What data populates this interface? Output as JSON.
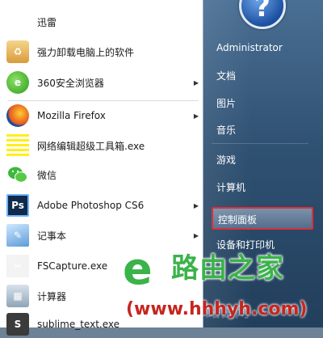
{
  "user": {
    "name": "Administrator",
    "avatar_glyph": "?"
  },
  "programs": [
    {
      "label": "迅雷",
      "icon": "xunlei-bird-icon",
      "icon_glyph": "✈",
      "has_arrow": false
    },
    {
      "label": "强力卸载电脑上的软件",
      "icon": "uninstall-box-icon",
      "icon_glyph": "♻",
      "has_arrow": false
    },
    {
      "label": "360安全浏览器",
      "icon": "360-browser-icon",
      "icon_glyph": "e",
      "has_arrow": true
    },
    {
      "label": "Mozilla Firefox",
      "icon": "firefox-icon",
      "icon_glyph": "",
      "has_arrow": true
    },
    {
      "label": "网络编辑超级工具箱.exe",
      "icon": "toolbox-yellow-icon",
      "icon_glyph": "",
      "has_arrow": false
    },
    {
      "label": "微信",
      "icon": "wechat-icon",
      "icon_glyph": "",
      "has_arrow": false
    },
    {
      "label": "Adobe Photoshop CS6",
      "icon": "photoshop-icon",
      "icon_glyph": "Ps",
      "has_arrow": true
    },
    {
      "label": "记事本",
      "icon": "notepad-icon",
      "icon_glyph": "✎",
      "has_arrow": true
    },
    {
      "label": "FSCapture.exe",
      "icon": "fscapture-icon",
      "icon_glyph": "✂",
      "has_arrow": false
    },
    {
      "label": "计算器",
      "icon": "calculator-icon",
      "icon_glyph": "▦",
      "has_arrow": false
    },
    {
      "label": "sublime_text.exe",
      "icon": "sublime-text-icon",
      "icon_glyph": "S",
      "has_arrow": false
    }
  ],
  "arrow_glyph": "▶",
  "right_items": [
    {
      "label": "文档"
    },
    {
      "label": "图片"
    },
    {
      "label": "音乐"
    },
    {
      "label": "游戏"
    },
    {
      "label": "计算机"
    },
    {
      "label": "控制面板",
      "highlighted": true
    },
    {
      "label": "设备和打印机"
    }
  ],
  "watermark": {
    "logo_glyph": "e",
    "name": "路由之家",
    "url": "(www.hhhyh.com)",
    "ghost": "路由网"
  },
  "colors": {
    "highlight_border": "#d9303a",
    "watermark_green": "#3ab34a",
    "watermark_red": "#c7241f"
  }
}
